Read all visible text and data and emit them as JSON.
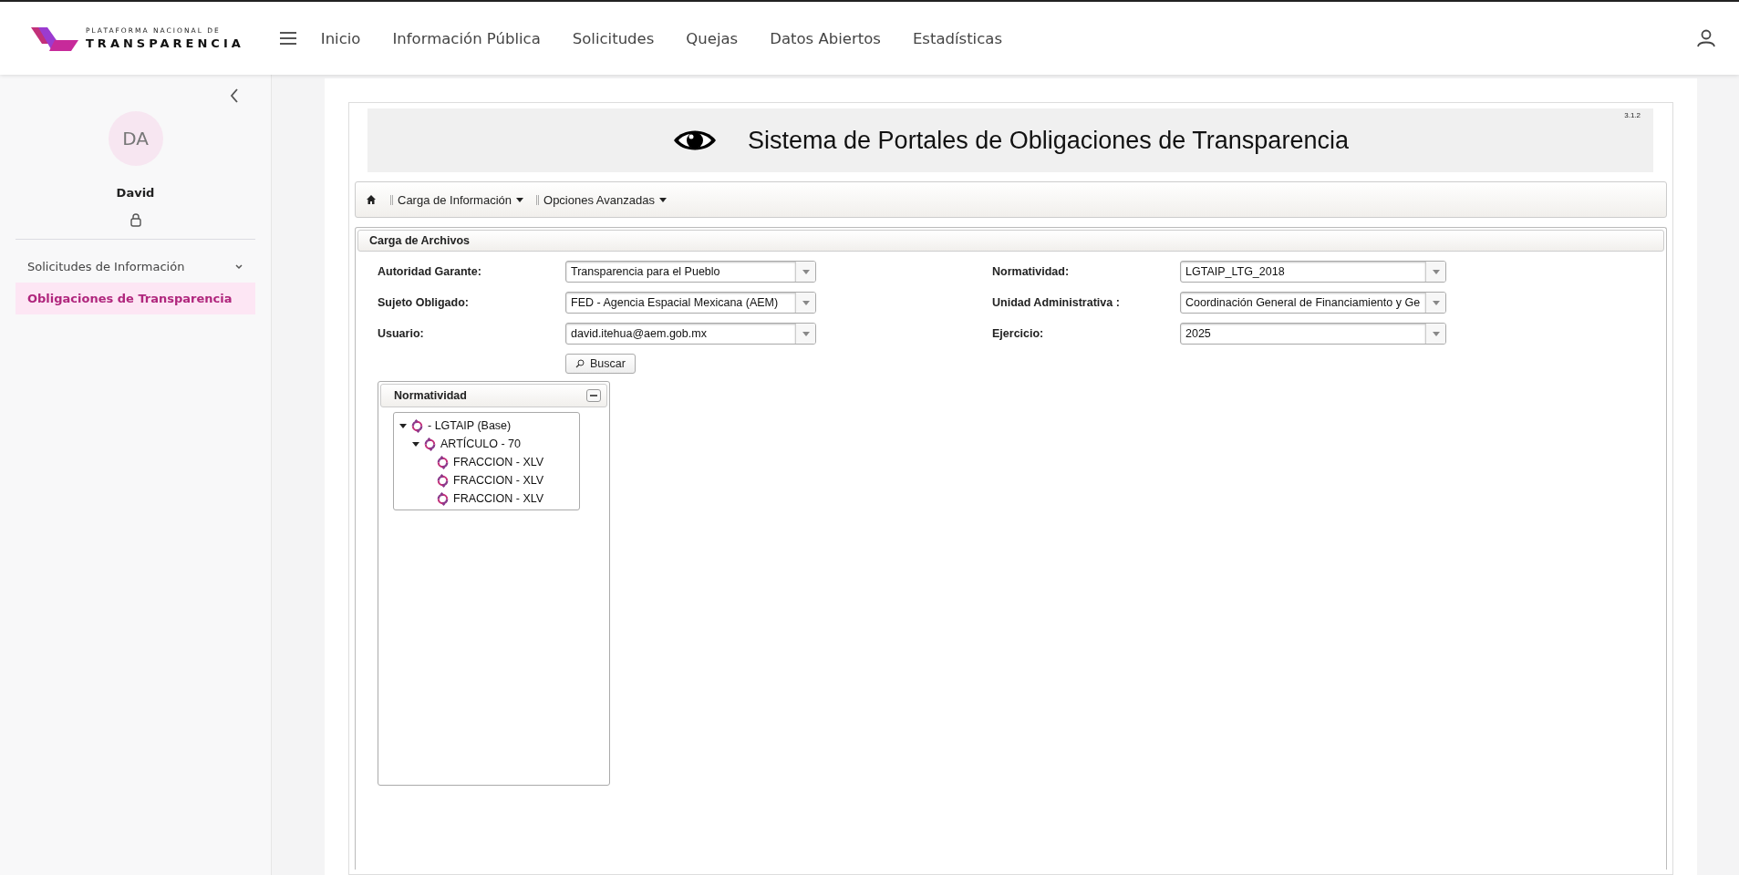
{
  "header": {
    "logo_top": "PLATAFORMA NACIONAL DE",
    "logo_bottom": "TRANSPARENCIA",
    "nav": [
      {
        "label": "Inicio"
      },
      {
        "label": "Información Pública"
      },
      {
        "label": "Solicitudes"
      },
      {
        "label": "Quejas"
      },
      {
        "label": "Datos Abiertos"
      },
      {
        "label": "Estadísticas"
      }
    ]
  },
  "sidebar": {
    "initials": "DA",
    "name": "David",
    "items": [
      {
        "label": "Solicitudes de Información",
        "selected": false,
        "expandable": true
      },
      {
        "label": "Obligaciones de Transparencia",
        "selected": true,
        "expandable": false
      }
    ]
  },
  "banner": {
    "version": "3.1.2",
    "title": "Sistema de Portales de Obligaciones de Transparencia"
  },
  "menu": [
    {
      "label": "Carga de Información"
    },
    {
      "label": "Opciones Avanzadas"
    }
  ],
  "panel": {
    "title": "Carga de Archivos",
    "fields": [
      {
        "label": "Autoridad Garante:",
        "value": "Transparencia para el Pueblo"
      },
      {
        "label": "Normatividad:",
        "value": "LGTAIP_LTG_2018"
      },
      {
        "label": "Sujeto Obligado:",
        "value": "FED - Agencia Espacial Mexicana (AEM)"
      },
      {
        "label": "Unidad Administrativa :",
        "value": "Coordinación General de Financiamiento y Ge"
      },
      {
        "label": "Usuario:",
        "value": "david.itehua@aem.gob.mx"
      },
      {
        "label": "Ejercicio:",
        "value": "2025"
      }
    ],
    "search_button": "Buscar"
  },
  "tree": {
    "title": "Normatividad",
    "nodes": [
      {
        "label": "- LGTAIP (Base)",
        "expanded": true,
        "children": [
          {
            "label": "ARTÍCULO - 70",
            "expanded": true,
            "children": [
              {
                "label": "FRACCION - XLV"
              },
              {
                "label": "FRACCION - XLV"
              },
              {
                "label": "FRACCION - XLV"
              }
            ]
          }
        ]
      }
    ]
  }
}
